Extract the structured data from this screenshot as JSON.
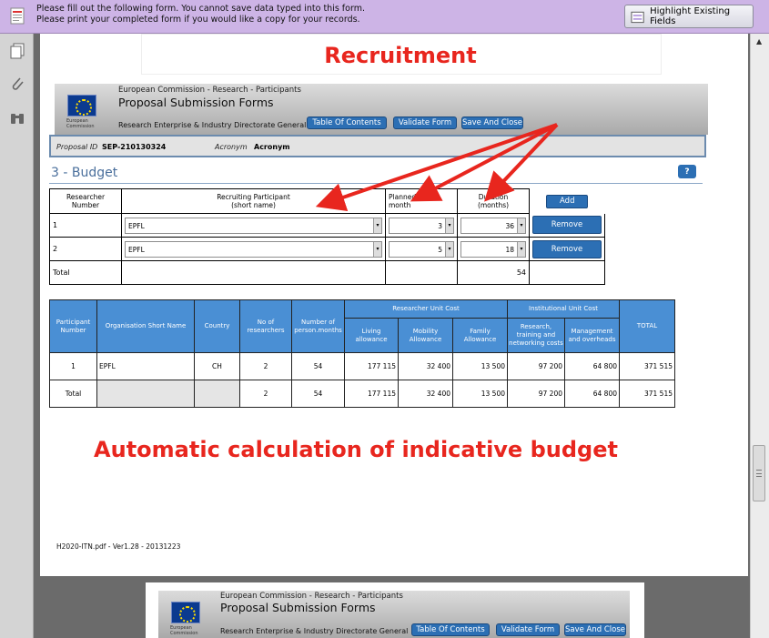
{
  "notice": {
    "line1": "Please fill out the following form. You cannot save data typed into this form.",
    "line2": "Please print your completed form if you would like a copy for your records.",
    "highlight_button": "Highlight Existing Fields"
  },
  "annotations": {
    "title": "Recruitment",
    "calc": "Automatic calculation of indicative budget"
  },
  "header": {
    "ec_line": "European Commission - Research - Participants",
    "psf": "Proposal Submission Forms",
    "directorate": "Research Enterprise & Industry Directorate General",
    "flag_caption_1": "European",
    "flag_caption_2": "Commission",
    "btn_toc": "Table Of Contents",
    "btn_validate": "Validate Form",
    "btn_save": "Save And Close"
  },
  "proposal": {
    "id_label": "Proposal ID",
    "id_value": "SEP-210130324",
    "acronym_label": "Acronym",
    "acronym_value": "Acronym"
  },
  "budget": {
    "heading": "3 - Budget",
    "help": "?"
  },
  "researchers": {
    "col_number": "Researcher Number",
    "col_participant_1": "Recruiting Participant",
    "col_participant_2": "(short name)",
    "col_start_1": "Planned start",
    "col_start_2": "month",
    "col_duration_1": "Duration",
    "col_duration_2": "(months)",
    "add": "Add",
    "rows": [
      {
        "num": "1",
        "participant": "EPFL",
        "start": "3",
        "duration": "36",
        "remove": "Remove"
      },
      {
        "num": "2",
        "participant": "EPFL",
        "start": "5",
        "duration": "18",
        "remove": "Remove"
      }
    ],
    "total_label": "Total",
    "total_value": "54"
  },
  "cost_table": {
    "h_participant": "Participant Number",
    "h_org": "Organisation Short Name",
    "h_country": "Country",
    "h_noresearchers": "No of researchers",
    "h_personmonths": "Number of person.months",
    "h_ruc": "Researcher Unit Cost",
    "h_iuc": "Institutional Unit Cost",
    "h_living": "Living allowance",
    "h_mobility": "Mobility Allowance",
    "h_family": "Family Allowance",
    "h_research": "Research, training and networking costs",
    "h_management": "Management and overheads",
    "h_total": "TOTAL",
    "rows": [
      {
        "num": "1",
        "org": "EPFL",
        "country": "CH",
        "nr": "2",
        "pm": "54",
        "living": "177 115",
        "mobility": "32 400",
        "family": "13 500",
        "research": "97 200",
        "management": "64 800",
        "total": "371 515"
      },
      {
        "num": "Total",
        "org": "",
        "country": "",
        "nr": "2",
        "pm": "54",
        "living": "177 115",
        "mobility": "32 400",
        "family": "13 500",
        "research": "97 200",
        "management": "64 800",
        "total": "371 515"
      }
    ]
  },
  "footer": {
    "version": "H2020-ITN.pdf - Ver1.28 -  20131223"
  }
}
